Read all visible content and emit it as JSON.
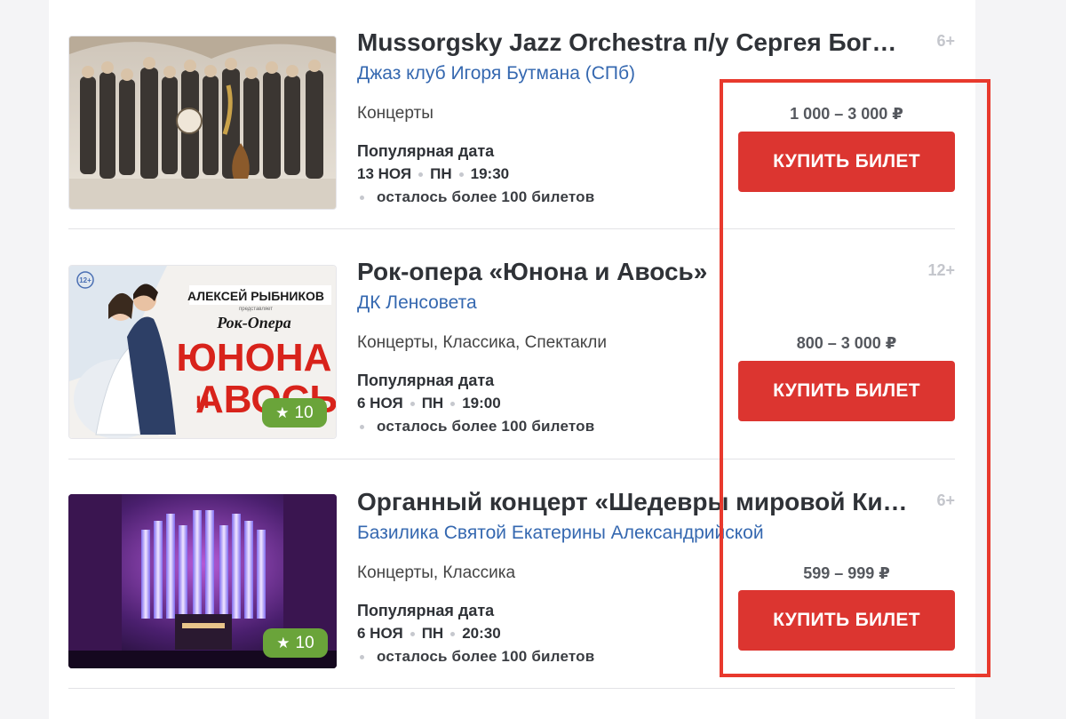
{
  "events": [
    {
      "title": "Mussorgsky Jazz Orchestra п/у Сергея Бог…",
      "age": "6+",
      "venue": "Джаз клуб Игоря Бутмана (СПб)",
      "category": "Концерты",
      "popular_label": "Популярная дата",
      "date": "13 НОЯ",
      "weekday": "ПН",
      "time": "19:30",
      "tickets": "осталось более 100 билетов",
      "price": "1 000 – 3 000 ₽",
      "buy_label": "КУПИТЬ БИЛЕТ"
    },
    {
      "title": "Рок-опера «Юнона и Авось»",
      "age": "12+",
      "venue": "ДК Ленсовета",
      "category": "Концерты, Классика, Спектакли",
      "popular_label": "Популярная дата",
      "date": "6 НОЯ",
      "weekday": "ПН",
      "time": "19:00",
      "tickets": "осталось более 100 билетов",
      "price": "800 – 3 000 ₽",
      "buy_label": "КУПИТЬ БИЛЕТ",
      "rating": "10",
      "poster": {
        "age_badge": "12+",
        "presenter": "АЛЕКСЕЙ РЫБНИКОВ",
        "presents": "представляет",
        "subtitle": "Рок-Опера",
        "title_line1": "ЮНОНА",
        "title_line2_small": "и",
        "title_line2": "АВОСЬ"
      }
    },
    {
      "title": "Органный концерт «Шедевры мировой Ки…",
      "age": "6+",
      "venue": "Базилика Святой Екатерины Александрийской",
      "category": "Концерты, Классика",
      "popular_label": "Популярная дата",
      "date": "6 НОЯ",
      "weekday": "ПН",
      "time": "20:30",
      "tickets": "осталось более 100 билетов",
      "price": "599 – 999 ₽",
      "buy_label": "КУПИТЬ БИЛЕТ",
      "rating": "10"
    }
  ],
  "colors": {
    "buy_button": "#dc3530",
    "venue_link": "#3568b0",
    "rating_badge": "#6aa43a",
    "highlight": "#e8392d"
  }
}
